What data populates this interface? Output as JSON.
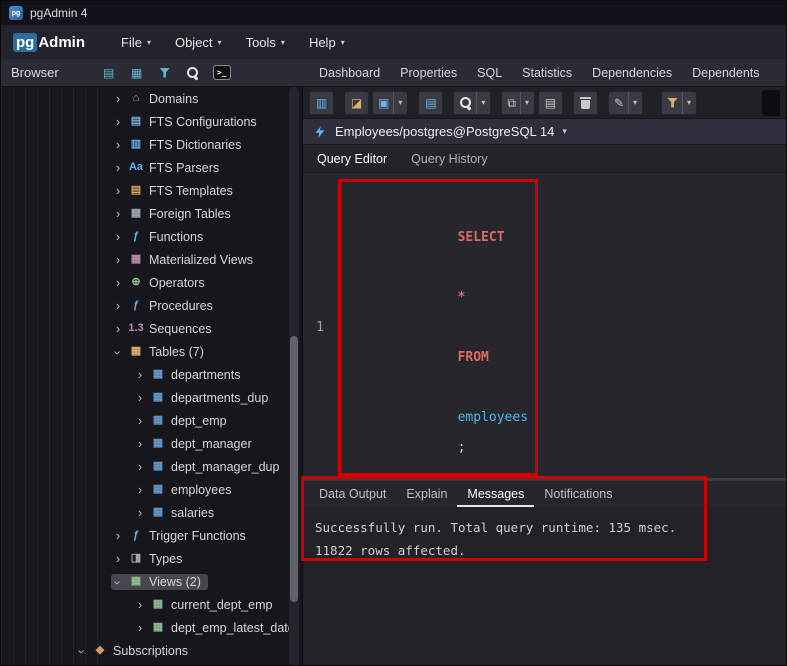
{
  "colors": {
    "annotation": "#cf0000",
    "keyword": "#e0695f",
    "identifier": "#4fb4f0",
    "plain": "#d4d4d4"
  },
  "titlebar": {
    "app_icon": "pg",
    "title": "pgAdmin 4"
  },
  "menubar": {
    "logo_pg": "pg",
    "logo_admin": "Admin",
    "menus": [
      {
        "label": "File",
        "name": "menu-file"
      },
      {
        "label": "Object",
        "name": "menu-object"
      },
      {
        "label": "Tools",
        "name": "menu-tools"
      },
      {
        "label": "Help",
        "name": "menu-help"
      }
    ]
  },
  "browser_panel": {
    "title": "Browser",
    "toolbar": [
      {
        "name": "servers-icon",
        "cls": "gl c-teal",
        "glyph": "▤"
      },
      {
        "name": "grid-icon",
        "cls": "gl c-teal",
        "glyph": "▦"
      },
      {
        "name": "filter-icon",
        "cls": "funnel c-teal",
        "glyph": ""
      },
      {
        "name": "search-icon",
        "cls": "mag c-white",
        "glyph": ""
      },
      {
        "name": "console-icon",
        "cls": "console",
        "glyph": ">_"
      }
    ]
  },
  "main_tabs": [
    {
      "label": "Dashboard",
      "name": "tab-dashboard"
    },
    {
      "label": "Properties",
      "name": "tab-properties"
    },
    {
      "label": "SQL",
      "name": "tab-sql"
    },
    {
      "label": "Statistics",
      "name": "tab-statistics"
    },
    {
      "label": "Dependencies",
      "name": "tab-dependencies"
    },
    {
      "label": "Dependents",
      "name": "tab-dependents"
    }
  ],
  "query_toolbar": [
    {
      "name": "file-icon",
      "btn_cls": "",
      "cls": "gl c-blue",
      "glyph": "▥",
      "dd": ""
    },
    {
      "name": "open-file-icon",
      "btn_cls": "grp",
      "cls": "gl c-amber",
      "glyph": "◪",
      "dd": ""
    },
    {
      "name": "save-icon",
      "btn_cls": "",
      "cls": "gl c-blue",
      "glyph": "▣",
      "dd": "▾"
    },
    {
      "name": "save-data-icon",
      "btn_cls": "grp",
      "cls": "gl c-blue",
      "glyph": "▤",
      "dd": ""
    },
    {
      "name": "find-icon",
      "btn_cls": "grp",
      "cls": "mag c-white",
      "glyph": "",
      "dd": "▾"
    },
    {
      "name": "copy-icon",
      "btn_cls": "grp",
      "cls": "gl c-gray",
      "glyph": "⧉",
      "dd": "▾"
    },
    {
      "name": "paste-icon",
      "btn_cls": "",
      "cls": "gl c-gray",
      "glyph": "▤",
      "dd": ""
    },
    {
      "name": "delete-icon",
      "btn_cls": "grp",
      "cls": "trash",
      "glyph": "",
      "dd": ""
    },
    {
      "name": "edit-icon",
      "btn_cls": "grp",
      "cls": "gl c-gray",
      "glyph": "✎",
      "dd": "▾"
    },
    {
      "name": "filter-icon",
      "btn_cls": "grp-lg",
      "cls": "funnel c-amber",
      "glyph": "",
      "dd": "▾"
    }
  ],
  "connection": {
    "label": "Employees/postgres@PostgreSQL 14",
    "caret": "▾"
  },
  "editor_tabs": [
    {
      "label": "Query Editor",
      "cls": "active",
      "name": "tab-query-editor"
    },
    {
      "label": "Query History",
      "cls": "",
      "name": "tab-query-history"
    }
  ],
  "editor": {
    "line_number": "1",
    "sql_tokens": [
      {
        "t": "SELECT",
        "cls": "tok-kw"
      },
      {
        "t": " ",
        "cls": "tok-pl"
      },
      {
        "t": "*",
        "cls": "tok-kw"
      },
      {
        "t": " ",
        "cls": "tok-pl"
      },
      {
        "t": "FROM",
        "cls": "tok-kw"
      },
      {
        "t": " ",
        "cls": "tok-pl"
      },
      {
        "t": "employees",
        "cls": "tok-id"
      },
      {
        "t": ";",
        "cls": "tok-pl"
      }
    ]
  },
  "tree": [
    {
      "name": "tree-item-domains",
      "label": "Domains",
      "row_cls": "lvl1",
      "chev": "›",
      "chev_cls": "",
      "ic": "⌂",
      "ic_color": "#d19a66"
    },
    {
      "name": "tree-item-fts-configurations",
      "label": "FTS Configurations",
      "row_cls": "lvl1",
      "chev": "›",
      "chev_cls": "",
      "ic": "▤",
      "ic_color": "#6fa8dc"
    },
    {
      "name": "tree-item-fts-dictionaries",
      "label": "FTS Dictionaries",
      "row_cls": "lvl1",
      "chev": "›",
      "chev_cls": "",
      "ic": "▥",
      "ic_color": "#6fa8dc"
    },
    {
      "name": "tree-item-fts-parsers",
      "label": "FTS Parsers",
      "row_cls": "lvl1",
      "chev": "›",
      "chev_cls": "",
      "ic": "Aa",
      "ic_color": "#56b6f2"
    },
    {
      "name": "tree-item-fts-templates",
      "label": "FTS Templates",
      "row_cls": "lvl1",
      "chev": "›",
      "chev_cls": "",
      "ic": "▤",
      "ic_color": "#d8a657"
    },
    {
      "name": "tree-item-foreign-tables",
      "label": "Foreign Tables",
      "row_cls": "lvl1",
      "chev": "›",
      "chev_cls": "",
      "ic": "▦",
      "ic_color": "#9aa7b0"
    },
    {
      "name": "tree-item-functions",
      "label": "Functions",
      "row_cls": "lvl1",
      "chev": "›",
      "chev_cls": "",
      "ic": "ƒ",
      "ic_color": "#56b6f2"
    },
    {
      "name": "tree-item-materialized-views",
      "label": "Materialized Views",
      "row_cls": "lvl1",
      "chev": "›",
      "chev_cls": "",
      "ic": "▦",
      "ic_color": "#b48ead"
    },
    {
      "name": "tree-item-operators",
      "label": "Operators",
      "row_cls": "lvl1",
      "chev": "›",
      "chev_cls": "",
      "ic": "⊕",
      "ic_color": "#8fbc8f"
    },
    {
      "name": "tree-item-procedures",
      "label": "Procedures",
      "row_cls": "lvl1",
      "chev": "›",
      "chev_cls": "",
      "ic": "ƒ",
      "ic_color": "#6fa8dc"
    },
    {
      "name": "tree-item-sequences",
      "label": "Sequences",
      "row_cls": "lvl1",
      "chev": "›",
      "chev_cls": "",
      "ic": "1.3",
      "ic_color": "#b48ead"
    },
    {
      "name": "tree-item-tables",
      "label": "Tables (7)",
      "row_cls": "lvl1",
      "chev": "›",
      "chev_cls": "exp",
      "ic": "▦",
      "ic_color": "#d8b06c"
    },
    {
      "name": "tree-item-departments",
      "label": "departments",
      "row_cls": "lvl2",
      "chev": "›",
      "chev_cls": "",
      "ic": "▦",
      "ic_color": "#6699cc"
    },
    {
      "name": "tree-item-departments-dup",
      "label": "departments_dup",
      "row_cls": "lvl2",
      "chev": "›",
      "chev_cls": "",
      "ic": "▦",
      "ic_color": "#6699cc"
    },
    {
      "name": "tree-item-dept-emp",
      "label": "dept_emp",
      "row_cls": "lvl2",
      "chev": "›",
      "chev_cls": "",
      "ic": "▦",
      "ic_color": "#6699cc"
    },
    {
      "name": "tree-item-dept-manager",
      "label": "dept_manager",
      "row_cls": "lvl2",
      "chev": "›",
      "chev_cls": "",
      "ic": "▦",
      "ic_color": "#6699cc"
    },
    {
      "name": "tree-item-dept-manager-dup",
      "label": "dept_manager_dup",
      "row_cls": "lvl2",
      "chev": "›",
      "chev_cls": "",
      "ic": "▦",
      "ic_color": "#6699cc"
    },
    {
      "name": "tree-item-employees",
      "label": "employees",
      "row_cls": "lvl2",
      "chev": "›",
      "chev_cls": "",
      "ic": "▦",
      "ic_color": "#6699cc"
    },
    {
      "name": "tree-item-salaries",
      "label": "salaries",
      "row_cls": "lvl2",
      "chev": "›",
      "chev_cls": "",
      "ic": "▦",
      "ic_color": "#6699cc"
    },
    {
      "name": "tree-item-trigger-functions",
      "label": "Trigger Functions",
      "row_cls": "lvl1",
      "chev": "›",
      "chev_cls": "",
      "ic": "ƒ",
      "ic_color": "#56b6f2"
    },
    {
      "name": "tree-item-types",
      "label": "Types",
      "row_cls": "lvl1",
      "chev": "›",
      "chev_cls": "",
      "ic": "◨",
      "ic_color": "#9aa7b0"
    },
    {
      "name": "tree-item-views",
      "label": "Views (2)",
      "row_cls": "lvl1 selected",
      "chev": "›",
      "chev_cls": "exp",
      "ic": "▦",
      "ic_color": "#8fbc8f"
    },
    {
      "name": "tree-item-current-dept-emp",
      "label": "current_dept_emp",
      "row_cls": "lvl2",
      "chev": "›",
      "chev_cls": "",
      "ic": "▦",
      "ic_color": "#8fbc8f"
    },
    {
      "name": "tree-item-dept-emp-latest-date",
      "label": "dept_emp_latest_date",
      "row_cls": "lvl2",
      "chev": "›",
      "chev_cls": "",
      "ic": "▦",
      "ic_color": "#8fbc8f"
    },
    {
      "name": "tree-item-subscriptions",
      "label": "Subscriptions",
      "row_cls": "lvl0",
      "chev": "›",
      "chev_cls": "exp",
      "ic": "◆",
      "ic_color": "#d19a66"
    }
  ],
  "bottom_tabs": [
    {
      "label": "Data Output",
      "cls": "",
      "name": "tab-data-output"
    },
    {
      "label": "Explain",
      "cls": "",
      "name": "tab-explain"
    },
    {
      "label": "Messages",
      "cls": "active",
      "name": "tab-messages"
    },
    {
      "label": "Notifications",
      "cls": "",
      "name": "tab-notifications"
    }
  ],
  "messages": {
    "lines": [
      {
        "text": "Successfully run. Total query runtime: 135 msec."
      },
      {
        "text": "11822 rows affected."
      }
    ]
  }
}
